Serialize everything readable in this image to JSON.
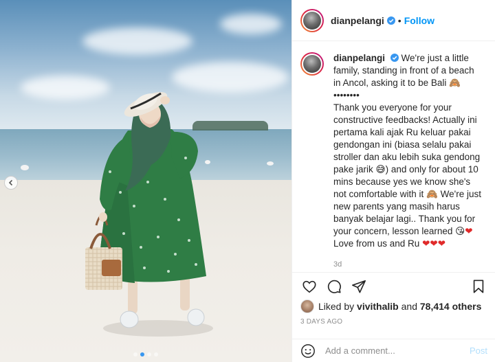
{
  "post": {
    "username": "dianpelangi",
    "follow_label": "Follow",
    "separator": "•",
    "caption": {
      "line1": "We're just a little family, standing in front of a beach in Ancol, asking it to be Bali",
      "dots": "••••••••",
      "line2": "Thank you everyone for your constructive feedbacks! Actually ini pertama kali ajak Ru keluar pakai gendongan ini (biasa selalu pakai stroller dan aku lebih suka gendong pake jarik",
      "line3": ") and only for about 10 mins because yes we know she's not comfortable with it",
      "line4": "We're just new parents yang masih harus banyak belajar lagi.. Thank you for your concern, lesson learned",
      "line5": "Love from us and Ru"
    },
    "caption_age": "3d",
    "likes": {
      "prefix": "Liked by",
      "user": "vivithalib",
      "and": "and",
      "count": "78,414 others"
    },
    "date": "3 DAYS AGO",
    "comment_input": {
      "placeholder": "Add a comment..."
    },
    "post_button": "Post",
    "colors": {
      "accent": "#0095f6",
      "heart": "#e02a2a",
      "story_ring_start": "#f09433",
      "story_ring_end": "#bc1888"
    },
    "carousel": {
      "slides": 4,
      "active": 1
    }
  }
}
